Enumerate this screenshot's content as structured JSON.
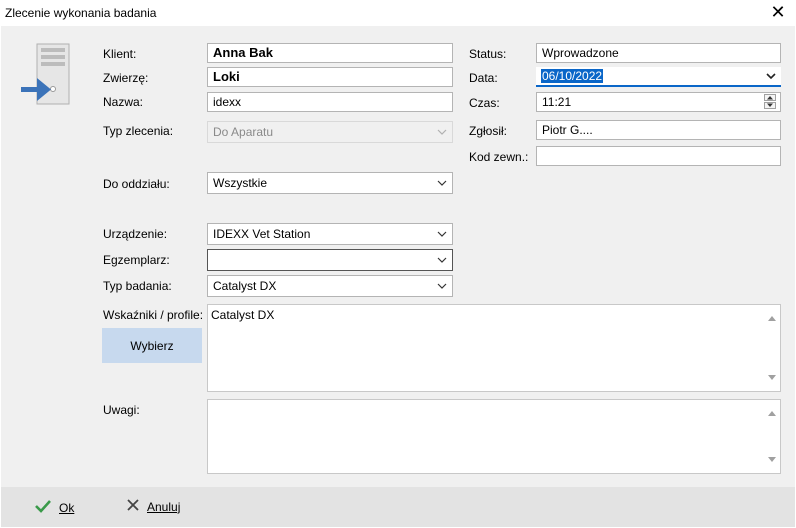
{
  "window": {
    "title": "Zlecenie wykonania badania"
  },
  "labels": {
    "klient": "Klient:",
    "zwierze": "Zwierzę:",
    "nazwa": "Nazwa:",
    "typ_zlecenia": "Typ zlecenia:",
    "do_oddzialu": "Do oddziału:",
    "urzadzenie": "Urządzenie:",
    "egzemplarz": "Egzemplarz:",
    "typ_badania": "Typ badania:",
    "wskazniki": "Wskaźniki / profile:",
    "uwagi": "Uwagi:",
    "status": "Status:",
    "data": "Data:",
    "czas": "Czas:",
    "zglosil": "Zgłosił:",
    "kod_zewn": "Kod zewn.:"
  },
  "values": {
    "klient": "Anna Bak",
    "zwierze": "Loki",
    "nazwa": "idexx",
    "typ_zlecenia": "Do Aparatu",
    "do_oddzialu": "Wszystkie",
    "urzadzenie": "IDEXX Vet Station",
    "egzemplarz": "",
    "typ_badania": "Catalyst DX",
    "wskazniki": "Catalyst DX",
    "uwagi": "",
    "status": "Wprowadzone",
    "data": "06/10/2022",
    "czas": "11:21",
    "zglosil": "Piotr G....",
    "kod_zewn": ""
  },
  "buttons": {
    "wybierz": "Wybierz",
    "ok": "Ok",
    "anuluj": "Anuluj"
  },
  "icons": {
    "header": "server-import-icon",
    "ok": "checkmark-icon",
    "anuluj": "x-icon"
  },
  "colors": {
    "accent": "#0a66c8",
    "button_bg": "#c7d9ee",
    "ok_check": "#3a9a4a",
    "arrow": "#3b73b9"
  }
}
